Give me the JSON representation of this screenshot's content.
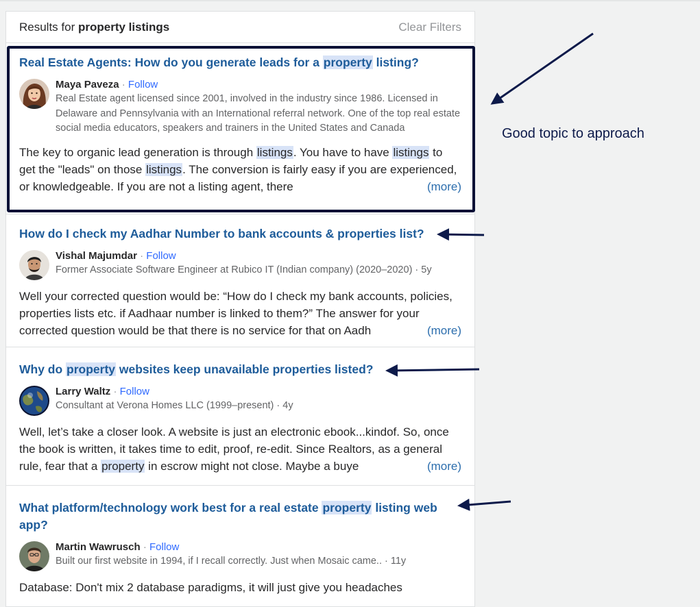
{
  "header": {
    "results_prefix": "Results for",
    "query": "property listings",
    "clear_filters": "Clear Filters"
  },
  "results": [
    {
      "title_parts": [
        {
          "text": "Real Estate Agents: How do you generate leads for a ",
          "hl": false
        },
        {
          "text": "property",
          "hl": true
        },
        {
          "text": " listing?",
          "hl": false
        }
      ],
      "author": "Maya Paveza",
      "follow": "Follow",
      "separator": "·",
      "credential": "Real Estate agent licensed since 2001, involved in the industry since 1986. Licensed in Delaware and Pennsylvania with an International referral network. One of the top real estate social media educators, speakers and trainers in the United States and Canada",
      "snippet_parts": [
        {
          "text": "The key to organic lead generation is through ",
          "hl": false
        },
        {
          "text": "listings",
          "hl": true
        },
        {
          "text": ". You have to have ",
          "hl": false
        },
        {
          "text": "listings",
          "hl": true
        },
        {
          "text": " to get the \"leads\" on those ",
          "hl": false
        },
        {
          "text": "listings",
          "hl": true
        },
        {
          "text": ". The conversion is fairly easy if you are experienced, or knowledgeable. If you are not a listing agent, there",
          "hl": false
        }
      ],
      "more": "(more)"
    },
    {
      "title_parts": [
        {
          "text": "How do I check my Aadhar Number to bank accounts & properties list?",
          "hl": false
        }
      ],
      "author": "Vishal Majumdar",
      "follow": "Follow",
      "separator": "·",
      "credential": "Former Associate Software Engineer at Rubico IT (Indian company) (2020–2020) · 5y",
      "snippet_parts": [
        {
          "text": "Well your corrected question would be: “How do I check my bank accounts, policies, properties lists etc. if Aadhaar number is linked to them?” The answer for your corrected question would be that there is no service for that on Aadh",
          "hl": false
        }
      ],
      "more": "(more)"
    },
    {
      "title_parts": [
        {
          "text": "Why do ",
          "hl": false
        },
        {
          "text": "property",
          "hl": true
        },
        {
          "text": " websites keep unavailable properties listed?",
          "hl": false
        }
      ],
      "author": "Larry Waltz",
      "follow": "Follow",
      "separator": "·",
      "credential": "Consultant at Verona Homes LLC (1999–present) · 4y",
      "snippet_parts": [
        {
          "text": "Well, let’s take a closer look. A website is just an electronic ebook...kindof. So, once the book is written, it takes time to edit, proof, re-edit. Since Realtors, as a general rule, fear that a ",
          "hl": false
        },
        {
          "text": "property",
          "hl": true
        },
        {
          "text": " in escrow might not close. Maybe a buye",
          "hl": false
        }
      ],
      "more": "(more)"
    },
    {
      "title_parts": [
        {
          "text": "What platform/technology work best for a real estate ",
          "hl": false
        },
        {
          "text": "property",
          "hl": true
        },
        {
          "text": " listing web app?",
          "hl": false
        }
      ],
      "author": "Martin Wawrusch",
      "follow": "Follow",
      "separator": "·",
      "credential": "Built our first website in 1994, if I recall correctly. Just when Mosaic came.. · 11y",
      "snippet_parts": [
        {
          "text": "Database: Don't mix 2 database paradigms, it will just give you headaches",
          "hl": false
        }
      ],
      "more": ""
    }
  ],
  "annotation": {
    "text": "Good topic to approach",
    "color": "#0d1a4a"
  },
  "colors": {
    "title": "#1e5c9a",
    "follow": "#2e69ff",
    "highlight": "#d8e3f7",
    "box_border": "#070f35"
  },
  "icons": {
    "avatar_1": "avatar-maya-paveza",
    "avatar_2": "avatar-vishal-majumdar",
    "avatar_3": "avatar-larry-waltz-globe",
    "avatar_4": "avatar-martin-wawrusch",
    "annotation_arrows": "arrow-icon"
  }
}
